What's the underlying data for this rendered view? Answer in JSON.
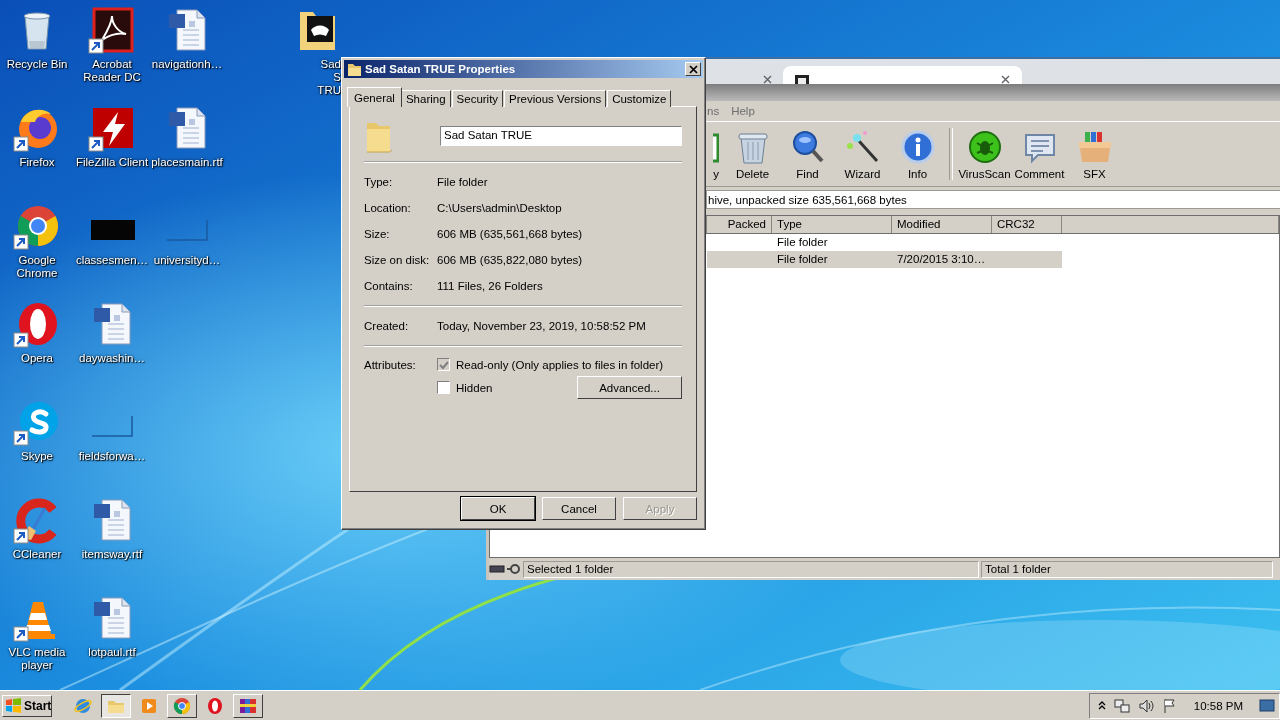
{
  "desktop": {
    "columns": [
      [
        {
          "label": "Recycle Bin",
          "kind": "recycle",
          "shortcut": false
        },
        {
          "label": "Firefox",
          "kind": "firefox",
          "shortcut": true
        },
        {
          "label": "Google Chrome",
          "kind": "chrome",
          "shortcut": true
        },
        {
          "label": "Opera",
          "kind": "opera",
          "shortcut": true
        },
        {
          "label": "Skype",
          "kind": "skype",
          "shortcut": true
        },
        {
          "label": "CCleaner",
          "kind": "ccleaner",
          "shortcut": true
        },
        {
          "label": "VLC media player",
          "kind": "vlc",
          "shortcut": true
        }
      ],
      [
        {
          "label": "Acrobat Reader DC",
          "kind": "acrobat",
          "shortcut": true
        },
        {
          "label": "FileZilla Client",
          "kind": "filezilla",
          "shortcut": true
        },
        {
          "label": "classesmen…",
          "kind": "dark-file",
          "shortcut": false
        },
        {
          "label": "daywashin…",
          "kind": "word",
          "shortcut": false
        },
        {
          "label": "fieldsforwa…",
          "kind": "blank-file",
          "shortcut": false
        },
        {
          "label": "itemsway.rtf",
          "kind": "word",
          "shortcut": false
        },
        {
          "label": "lotpaul.rtf",
          "kind": "word",
          "shortcut": false
        }
      ],
      [
        {
          "label": "navigationh…",
          "kind": "word",
          "shortcut": false
        },
        {
          "label": "placesmain.rtf",
          "kind": "word",
          "shortcut": false
        },
        {
          "label": "universityd…",
          "kind": "blank-file",
          "shortcut": false
        }
      ]
    ],
    "partial_icon": {
      "label": "Sad S TRU",
      "kind": "game-folder",
      "shortcut": false
    }
  },
  "archiver": {
    "menu": [
      "ns",
      "Help"
    ],
    "toolbar_groups": [
      [
        {
          "label": "y",
          "kind": "view"
        },
        {
          "label": "Delete",
          "kind": "trash"
        },
        {
          "label": "Find",
          "kind": "find"
        },
        {
          "label": "Wizard",
          "kind": "wand"
        },
        {
          "label": "Info",
          "kind": "info"
        }
      ],
      [
        {
          "label": "VirusScan",
          "kind": "virus"
        },
        {
          "label": "Comment",
          "kind": "comment"
        },
        {
          "label": "SFX",
          "kind": "sfx"
        }
      ]
    ],
    "address": "hive, unpacked size 635,561,668 bytes",
    "columns": [
      "Packed",
      "Type",
      "Modified",
      "CRC32"
    ],
    "rows": [
      {
        "type": "File folder",
        "selected": false
      },
      {
        "type": "File folder",
        "modified": "7/20/2015 3:10…",
        "selected": true
      }
    ],
    "status": [
      "Selected 1 folder",
      "Total 1 folder"
    ]
  },
  "dialog": {
    "title": "Sad Satan TRUE Properties",
    "tabs": [
      {
        "label": "General",
        "selected": true
      },
      {
        "label": "Sharing",
        "selected": false
      },
      {
        "label": "Security",
        "selected": false
      },
      {
        "label": "Previous Versions",
        "selected": false
      },
      {
        "label": "Customize",
        "selected": false
      }
    ],
    "name": "Sad Satan TRUE",
    "details": [
      {
        "label": "Type:",
        "value": "File folder"
      },
      {
        "label": "Location:",
        "value": "C:\\Users\\admin\\Desktop"
      },
      {
        "label": "Size:",
        "value": "606 MB (635,561,668 bytes)"
      },
      {
        "label": "Size on disk:",
        "value": "606 MB (635,822,080 bytes)"
      },
      {
        "label": "Contains:",
        "value": "111 Files, 26 Folders"
      }
    ],
    "dates": [
      {
        "label": "Created:",
        "value": "Today, November 23, 2019, 10:58:52 PM"
      }
    ],
    "attributes_label": "Attributes:",
    "attributes": [
      {
        "label": "Read-only (Only applies to files in folder)",
        "checked": true,
        "disabled": true
      },
      {
        "label": "Hidden",
        "checked": false,
        "disabled": false
      }
    ],
    "advanced": "Advanced...",
    "buttons": [
      {
        "label": "OK",
        "default": true,
        "disabled": false
      },
      {
        "label": "Cancel",
        "default": false,
        "disabled": false
      },
      {
        "label": "Apply",
        "default": false,
        "disabled": true
      }
    ]
  },
  "taskbar": {
    "start": "Start",
    "apps": [
      {
        "kind": "ie",
        "running": false,
        "selected": false
      },
      {
        "kind": "explorer",
        "running": true,
        "selected": true
      },
      {
        "kind": "media",
        "running": false,
        "selected": false
      },
      {
        "kind": "chrome",
        "running": true,
        "selected": false
      },
      {
        "kind": "opera",
        "running": false,
        "selected": false
      },
      {
        "kind": "winrar",
        "running": true,
        "selected": false
      }
    ],
    "clock": "10:58 PM"
  }
}
